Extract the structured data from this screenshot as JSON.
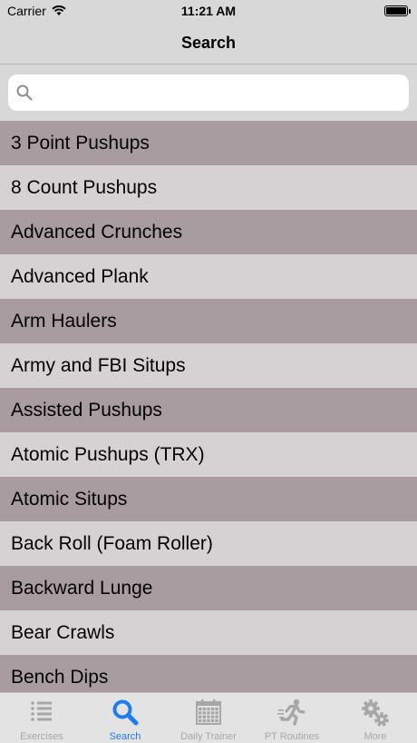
{
  "status_bar": {
    "carrier": "Carrier",
    "time": "11:21 AM"
  },
  "nav": {
    "title": "Search"
  },
  "search": {
    "placeholder": "",
    "value": ""
  },
  "exercises": [
    "3 Point Pushups",
    "8 Count Pushups",
    "Advanced Crunches",
    "Advanced Plank",
    "Arm Haulers",
    "Army and FBI Situps",
    "Assisted Pushups",
    "Atomic Pushups (TRX)",
    "Atomic Situps",
    "Back Roll (Foam Roller)",
    "Backward Lunge",
    "Bear Crawls",
    "Bench Dips"
  ],
  "tabs": [
    {
      "label": "Exercises",
      "icon": "list-icon",
      "active": false
    },
    {
      "label": "Search",
      "icon": "search-icon",
      "active": true
    },
    {
      "label": "Daily Trainer",
      "icon": "calendar-icon",
      "active": false
    },
    {
      "label": "PT Routines",
      "icon": "running-icon",
      "active": false
    },
    {
      "label": "More",
      "icon": "gears-icon",
      "active": false
    }
  ],
  "colors": {
    "row_dark": "#a89ca0",
    "row_light": "#d6d1d3",
    "tab_active": "#1e7cf2",
    "tab_inactive": "#a7a7a7"
  }
}
